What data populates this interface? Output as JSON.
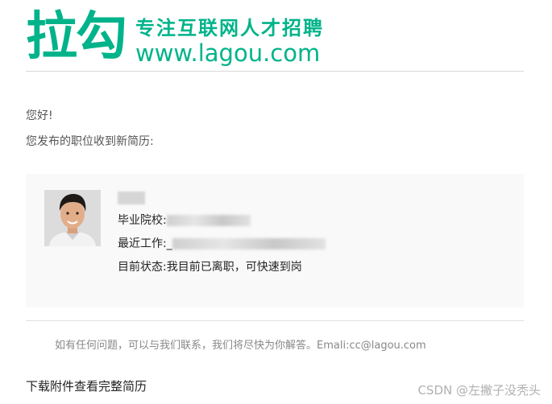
{
  "header": {
    "logo_text": "拉勾",
    "slogan": "专注互联网人才招聘",
    "site_url": "www.lagou.com"
  },
  "greeting": "您好!",
  "intro": "您发布的职位收到新简历:",
  "candidate": {
    "school_label": "毕业院校:",
    "recent_job_label": "最近工作:_",
    "status_label": "目前状态:",
    "status_value": "我目前已离职，可快速到岗"
  },
  "footer_note": "如有任何问题，可以与我们联系，我们将尽快为你解答。Emali:cc@lagou.com",
  "download_link": "下载附件查看完整简历",
  "watermark": "CSDN @左撇子没秃头",
  "colors": {
    "brand": "#00b38a",
    "card_bg": "#f9f9f9"
  }
}
